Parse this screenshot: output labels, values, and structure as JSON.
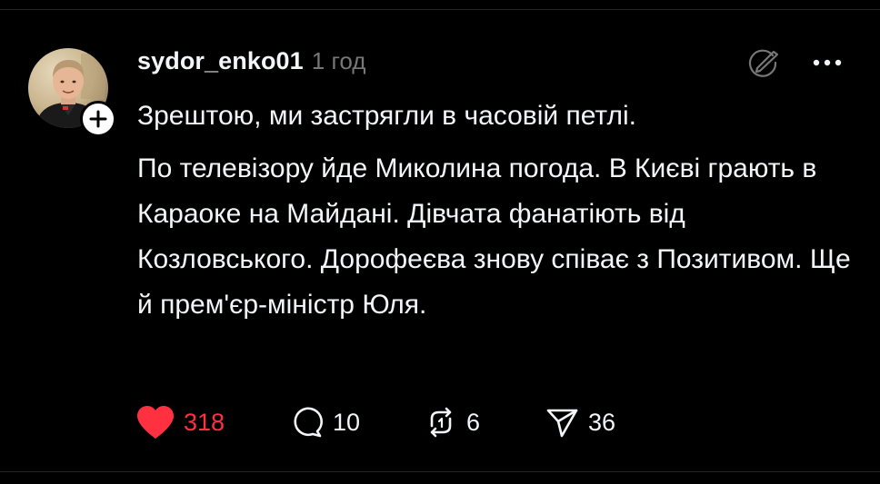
{
  "post": {
    "username": "sydor_enko01",
    "timestamp": "1 год",
    "paragraphs": [
      "Зрештою, ми застрягли в часовій петлі.",
      "По телевізору йде Миколина погода. В Києві грають в Караоке на Майдані. Дівчата фанатіють від Козловського. Дорофеєва знову співає з Позитивом. Ще й прем'єр-міністр Юля."
    ]
  },
  "actions": {
    "likes": "318",
    "replies": "10",
    "reposts": "6",
    "shares": "36"
  },
  "icons": {
    "avatar": "avatar-photo",
    "follow": "plus-icon",
    "edit": "pencil-circle-icon",
    "more": "more-dots-icon",
    "like": "heart-icon",
    "reply": "comment-bubble-icon",
    "repost": "repost-icon",
    "share": "send-icon"
  },
  "colors": {
    "background": "#000000",
    "text": "#f3f5f7",
    "muted": "#777777",
    "like_active": "#ff3040"
  }
}
